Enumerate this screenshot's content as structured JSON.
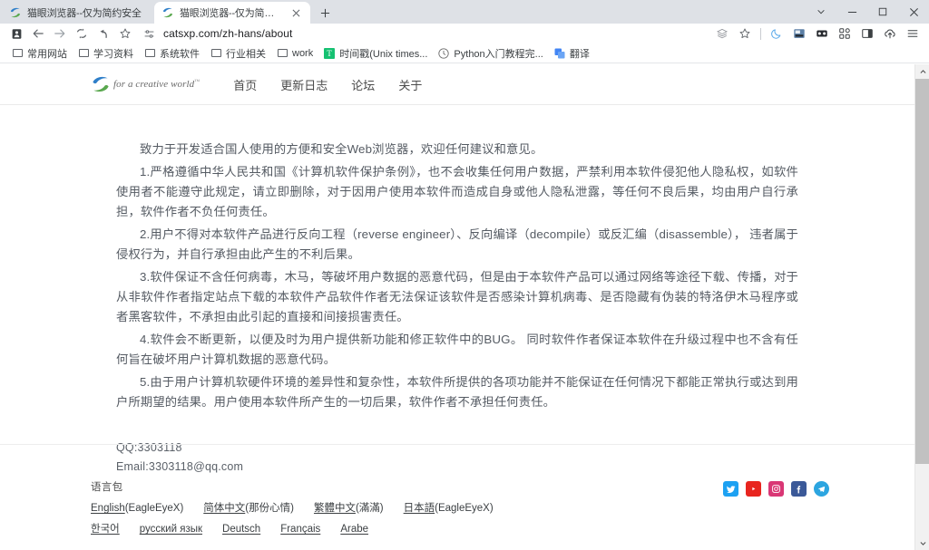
{
  "browser": {
    "tabs": [
      {
        "title": "猫眼浏览器--仅为简约安全",
        "active": false,
        "favicon": "catsxp-logo-icon"
      },
      {
        "title": "猫眼浏览器--仅为简约安全",
        "active": true,
        "favicon": "catsxp-logo-icon"
      }
    ],
    "new_tab_label": "+",
    "window_controls": {
      "expand": "chevron-down-icon",
      "minimize": "minimize-icon",
      "maximize": "maximize-icon",
      "close": "close-icon"
    },
    "nav": {
      "profile": "profile-badge-icon",
      "back": "back-arrow-icon",
      "forward": "forward-arrow-icon",
      "reload": "reload-icon",
      "home": "home-arrow-icon",
      "bookmark_star": "star-icon",
      "site_settings": "sliders-icon"
    },
    "url": "catsxp.com/zh-hans/about",
    "toolbar_right": [
      {
        "name": "layers-icon",
        "label": ""
      },
      {
        "name": "star-icon",
        "label": ""
      },
      {
        "name": "moon-icon",
        "label": ""
      },
      {
        "name": "screenshot-icon",
        "label": ""
      },
      {
        "name": "glasses-icon",
        "label": ""
      },
      {
        "name": "apps-grid-icon",
        "label": ""
      },
      {
        "name": "split-panel-icon",
        "label": ""
      },
      {
        "name": "cloud-upload-icon",
        "label": ""
      },
      {
        "name": "menu-icon",
        "label": ""
      }
    ],
    "bookmarks": [
      {
        "label": "常用网站",
        "icon": "folder-icon"
      },
      {
        "label": "学习资料",
        "icon": "folder-icon"
      },
      {
        "label": "系统软件",
        "icon": "folder-icon"
      },
      {
        "label": "行业相关",
        "icon": "folder-icon"
      },
      {
        "label": "work",
        "icon": "folder-icon"
      },
      {
        "label": "时间戳(Unix times...",
        "icon": "timestamp-favicon"
      },
      {
        "label": "Python入门教程完...",
        "icon": "python-favicon"
      },
      {
        "label": "翻译",
        "icon": "translate-favicon"
      }
    ]
  },
  "site": {
    "brand": {
      "tagline": "for a creative world",
      "tm": "™"
    },
    "nav": [
      {
        "label": "首页"
      },
      {
        "label": "更新日志"
      },
      {
        "label": "论坛"
      },
      {
        "label": "关于"
      }
    ],
    "article": {
      "intro": "致力于开发适合国人使用的方便和安全Web浏览器，欢迎任何建议和意见。",
      "paragraphs": [
        "1.严格遵循中华人民共和国《计算机软件保护条例》，也不会收集任何用户数据，严禁利用本软件侵犯他人隐私权，如软件使用者不能遵守此规定，请立即删除，对于因用户使用本软件而造成自身或他人隐私泄露，等任何不良后果，均由用户自行承担，软件作者不负任何责任。",
        "2.用户不得对本软件产品进行反向工程（reverse engineer）、反向编译（decompile）或反汇编（disassemble），  违者属于侵权行为，并自行承担由此产生的不利后果。",
        "3.软件保证不含任何病毒，木马，等破坏用户数据的恶意代码，但是由于本软件产品可以通过网络等途径下载、传播，对于从非软件作者指定站点下载的本软件产品软件作者无法保证该软件是否感染计算机病毒、是否隐藏有伪装的特洛伊木马程序或者黑客软件，不承担由此引起的直接和间接损害责任。",
        "4.软件会不断更新，以便及时为用户提供新功能和修正软件中的BUG。 同时软件作者保证本软件在升级过程中也不含有任何旨在破坏用户计算机数据的恶意代码。",
        "5.由于用户计算机软硬件环境的差异性和复杂性，本软件所提供的各项功能并不能保证在任何情况下都能正常执行或达到用户所期望的结果。用户使用本软件所产生的一切后果，软件作者不承担任何责任。"
      ],
      "contact": [
        "QQ:3303118",
        "Email:3303118@qq.com"
      ]
    },
    "footer": {
      "lang_title": "语言包",
      "lang_row1": [
        {
          "link": "English",
          "paren": "(EagleEyeX)"
        },
        {
          "link": "简体中文",
          "paren": "(那份心情)"
        },
        {
          "link": "繁體中文",
          "paren": "(滿滿)"
        },
        {
          "link": "日本語",
          "paren": "(EagleEyeX)"
        }
      ],
      "lang_row2": [
        {
          "link": "한국어",
          "paren": ""
        },
        {
          "link": "русский язык",
          "paren": ""
        },
        {
          "link": "Deutsch",
          "paren": ""
        },
        {
          "link": "Français",
          "paren": ""
        },
        {
          "link": "Arabe",
          "paren": ""
        }
      ],
      "social": [
        {
          "name": "twitter-icon",
          "color": "#1da1f2"
        },
        {
          "name": "youtube-icon",
          "color": "#e8251f"
        },
        {
          "name": "instagram-icon",
          "color": "#d93775"
        },
        {
          "name": "facebook-icon",
          "color": "#3b5998"
        },
        {
          "name": "telegram-icon",
          "color": "#2ca5e0"
        }
      ]
    }
  },
  "colors": {
    "tabstrip_bg": "#dee1e6",
    "text": "#555b63",
    "accent_green": "#5aa84f",
    "accent_blue": "#2f7fc9"
  }
}
